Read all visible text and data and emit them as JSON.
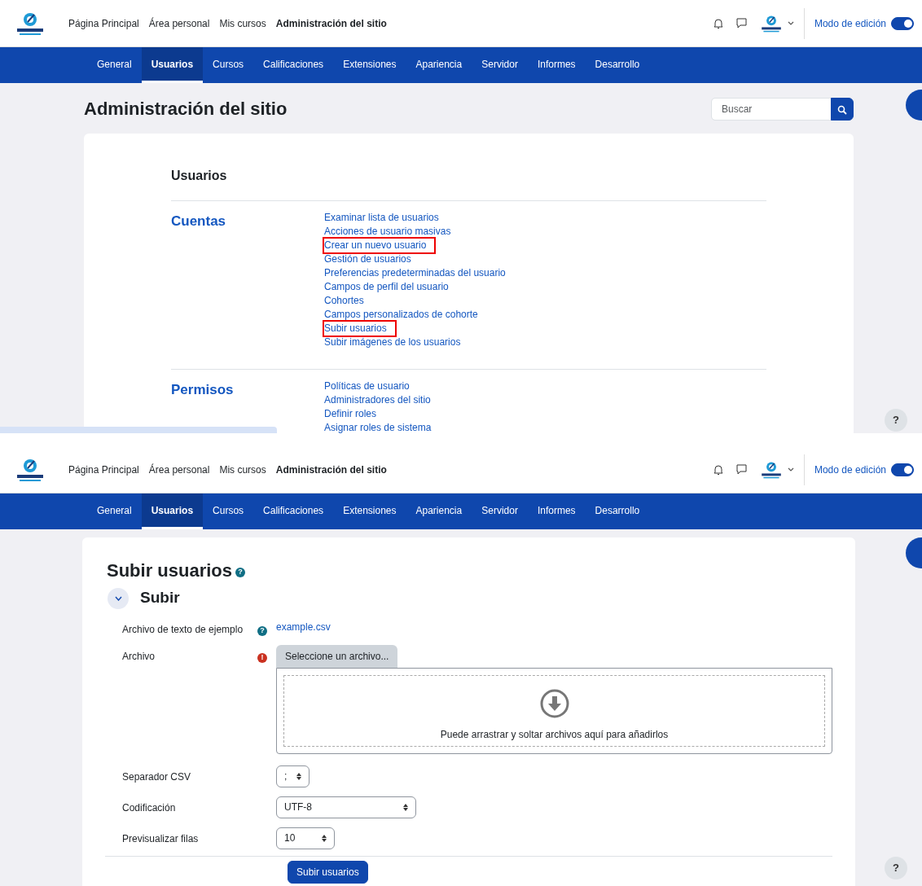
{
  "screens": [
    {
      "header": {
        "nav": [
          {
            "label": "Página Principal",
            "selected": false
          },
          {
            "label": "Área personal",
            "selected": false
          },
          {
            "label": "Mis cursos",
            "selected": false
          },
          {
            "label": "Administración del sitio",
            "selected": true
          }
        ],
        "edit_mode": {
          "label": "Modo de edición",
          "on": true
        }
      },
      "tabs": [
        {
          "label": "General",
          "selected": false
        },
        {
          "label": "Usuarios",
          "selected": true
        },
        {
          "label": "Cursos",
          "selected": false
        },
        {
          "label": "Calificaciones",
          "selected": false
        },
        {
          "label": "Extensiones",
          "selected": false
        },
        {
          "label": "Apariencia",
          "selected": false
        },
        {
          "label": "Servidor",
          "selected": false
        },
        {
          "label": "Informes",
          "selected": false
        },
        {
          "label": "Desarrollo",
          "selected": false
        }
      ],
      "kind": "admin",
      "page_title": "Administración del sitio",
      "search": {
        "placeholder": "Buscar"
      },
      "card": {
        "heading": "Usuarios",
        "sections": [
          {
            "title": "Cuentas",
            "links": [
              {
                "label": "Examinar lista de usuarios",
                "highlighted": false
              },
              {
                "label": "Acciones de usuario masivas",
                "highlighted": false
              },
              {
                "label": "Crear un nuevo usuario",
                "highlighted": true
              },
              {
                "label": "Gestión de usuarios",
                "highlighted": false
              },
              {
                "label": "Preferencias predeterminadas del usuario",
                "highlighted": false
              },
              {
                "label": "Campos de perfil del usuario",
                "highlighted": false
              },
              {
                "label": "Cohortes",
                "highlighted": false
              },
              {
                "label": "Campos personalizados de cohorte",
                "highlighted": false
              },
              {
                "label": "Subir usuarios",
                "highlighted": true
              },
              {
                "label": "Subir imágenes de los usuarios",
                "highlighted": false
              }
            ]
          },
          {
            "title": "Permisos",
            "links": [
              {
                "label": "Políticas de usuario",
                "highlighted": false
              },
              {
                "label": "Administradores del sitio",
                "highlighted": false
              },
              {
                "label": "Definir roles",
                "highlighted": false
              },
              {
                "label": "Asignar roles de sistema",
                "highlighted": false
              }
            ]
          }
        ]
      },
      "help_button": "?"
    },
    {
      "header": {
        "nav": [
          {
            "label": "Página Principal",
            "selected": false
          },
          {
            "label": "Área personal",
            "selected": false
          },
          {
            "label": "Mis cursos",
            "selected": false
          },
          {
            "label": "Administración del sitio",
            "selected": true
          }
        ],
        "edit_mode": {
          "label": "Modo de edición",
          "on": true
        }
      },
      "tabs": [
        {
          "label": "General",
          "selected": false
        },
        {
          "label": "Usuarios",
          "selected": true
        },
        {
          "label": "Cursos",
          "selected": false
        },
        {
          "label": "Calificaciones",
          "selected": false
        },
        {
          "label": "Extensiones",
          "selected": false
        },
        {
          "label": "Apariencia",
          "selected": false
        },
        {
          "label": "Servidor",
          "selected": false
        },
        {
          "label": "Informes",
          "selected": false
        },
        {
          "label": "Desarrollo",
          "selected": false
        }
      ],
      "kind": "form",
      "page_title": "Subir usuarios",
      "title_help": "?",
      "section": {
        "title": "Subir",
        "expanded": true
      },
      "fields": [
        {
          "label": "Archivo de texto de ejemplo",
          "badge": {
            "kind": "help",
            "text": "?"
          },
          "kind": "link",
          "value": "example.csv"
        },
        {
          "label": "Archivo",
          "badge": {
            "kind": "required",
            "text": "!"
          },
          "kind": "file",
          "button": "Seleccione un archivo...",
          "drop_text": "Puede arrastrar y soltar archivos aquí para añadirlos"
        },
        {
          "label": "Separador CSV",
          "kind": "select",
          "value": ";"
        },
        {
          "label": "Codificación",
          "kind": "select",
          "value": "UTF-8"
        },
        {
          "label": "Previsualizar filas",
          "kind": "select",
          "value": "10"
        }
      ],
      "submit": "Subir usuarios",
      "help_button": "?"
    }
  ]
}
